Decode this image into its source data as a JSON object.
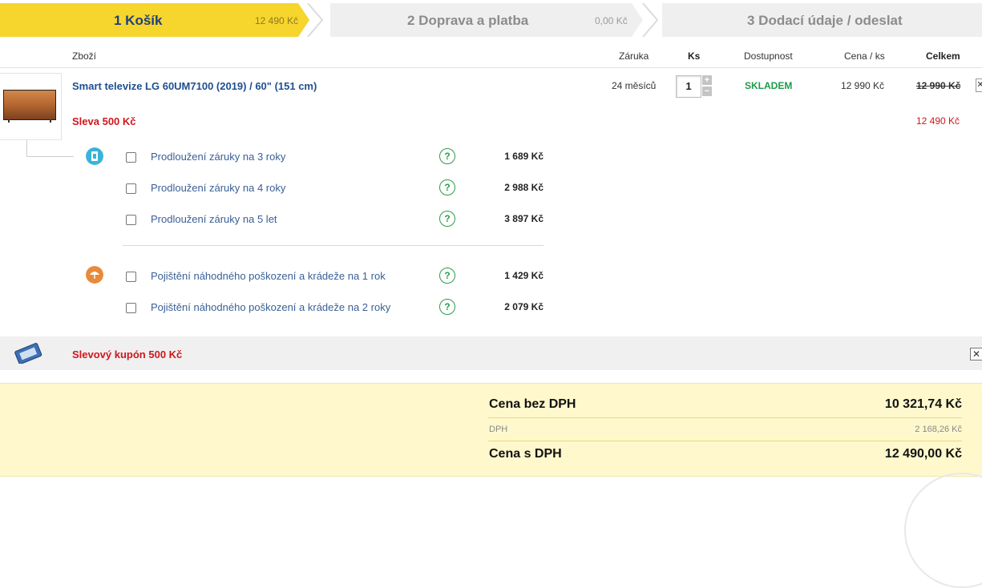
{
  "steps": [
    {
      "label": "1 Košík",
      "amount": "12 490 Kč"
    },
    {
      "label": "2 Doprava a platba",
      "amount": "0,00  Kč"
    },
    {
      "label": "3 Dodací údaje / odeslat"
    }
  ],
  "table_header": {
    "goods": "Zboží",
    "warranty": "Záruka",
    "qty": "Ks",
    "availability": "Dostupnost",
    "unit_price": "Cena / ks",
    "total": "Celkem"
  },
  "product": {
    "name": "Smart televize LG 60UM7100 (2019) / 60\" (151 cm)",
    "warranty": "24 měsíců",
    "quantity": "1",
    "availability": "SKLADEM",
    "unit_price": "12 990 Kč",
    "total_original": "12 990 Kč",
    "discount": "Sleva 500 Kč",
    "total_discounted": "12 490 Kč",
    "plus": "+",
    "minus": "−",
    "remove": "✕"
  },
  "services": {
    "warranty_extensions": [
      {
        "label": "Prodloužení záruky na 3 roky",
        "price": "1 689 Kč"
      },
      {
        "label": "Prodloužení záruky na 4 roky",
        "price": "2 988 Kč"
      },
      {
        "label": "Prodloužení záruky na 5 let",
        "price": "3 897 Kč"
      }
    ],
    "insurance": [
      {
        "label": "Pojištění náhodného poškození a krádeže na 1 rok",
        "price": "1 429 Kč"
      },
      {
        "label": "Pojištění náhodného poškození a krádeže na 2 roky",
        "price": "2 079 Kč"
      }
    ],
    "help": "?"
  },
  "coupon": {
    "label": "Slevový kupón 500 Kč",
    "close": "✕"
  },
  "summary": {
    "without_vat_label": "Cena bez DPH",
    "without_vat_value": "10 321,74 Kč",
    "vat_label": "DPH",
    "vat_value": "2 168,26 Kč",
    "with_vat_label": "Cena s DPH",
    "with_vat_value": "12 490,00 Kč"
  },
  "colors": {
    "active_step": "#f6d52c",
    "inactive_step": "#efefef",
    "link_blue": "#1f4f8f",
    "red": "#d0161b",
    "green": "#1e9b4a",
    "summary_bg": "#fff8cc"
  }
}
